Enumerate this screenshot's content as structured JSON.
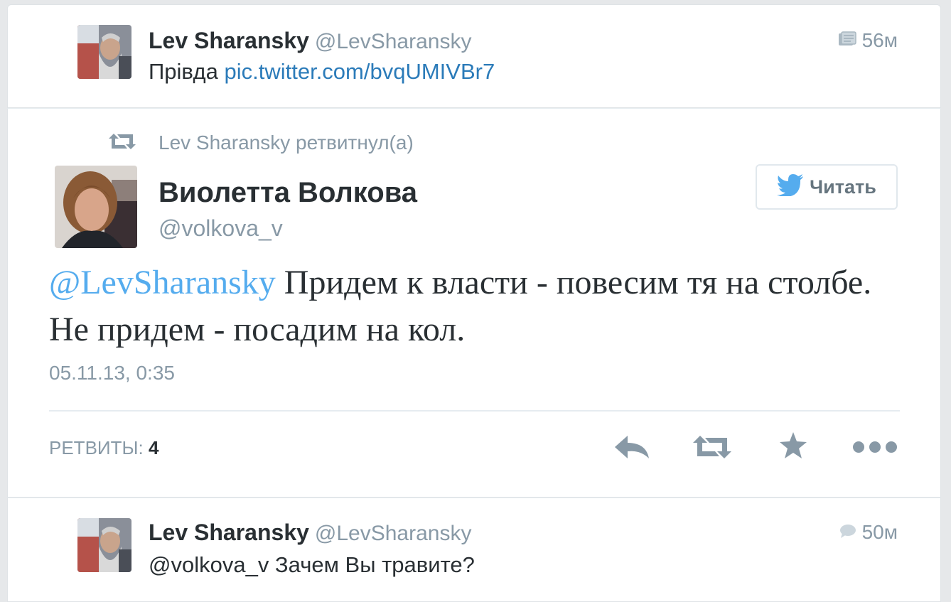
{
  "tweets": [
    {
      "author_name": "Lev Sharansky",
      "author_handle": "@LevSharansky",
      "text_prefix": "Прівда",
      "link_text": "pic.twitter.com/bvqUMIVBr7",
      "time": "56м",
      "meta_icon": "media-icon"
    },
    {
      "retweeted_by": "Lev Sharansky ретвитнул(а)",
      "author_name": "Виолетта Волкова",
      "author_handle": "@volkova_v",
      "follow_label": "Читать",
      "mention": "@LevSharansky",
      "text": "Придем к власти - повесим тя на столбе. Не придем - посадим на кол.",
      "timestamp": "05.11.13, 0:35",
      "retweets_label": "РЕТВИТЫ:",
      "retweets_count": "4",
      "actions": [
        "reply-icon",
        "retweet-icon",
        "favorite-icon",
        "more-icon"
      ]
    },
    {
      "author_name": "Lev Sharansky",
      "author_handle": "@LevSharansky",
      "text": "@volkova_v Зачем Вы травите?",
      "time": "50м",
      "meta_icon": "reply-bubble-icon"
    }
  ],
  "colors": {
    "link": "#2b7bb9",
    "muted": "#8899a6",
    "text": "#292f33",
    "twitter_blue": "#55acee"
  }
}
